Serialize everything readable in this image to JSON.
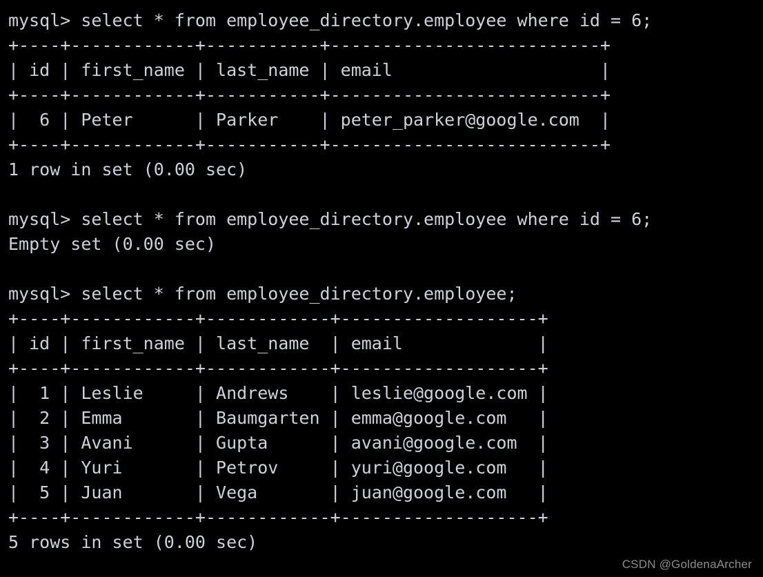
{
  "terminal": {
    "background_color": "#000000",
    "text_color": "#ccd2dc",
    "prompt": "mysql>",
    "lines": [
      {
        "id": "block1-prompt",
        "kind": "prompt",
        "text": "mysql> select * from employee_directory.employee where id = 6;"
      },
      {
        "id": "block1-rule-top",
        "kind": "rule",
        "text": "+----+------------+-----------+--------------------------+"
      },
      {
        "id": "block1-header",
        "kind": "table-row",
        "text": "| id | first_name | last_name | email                    |"
      },
      {
        "id": "block1-rule-mid",
        "kind": "rule",
        "text": "+----+------------+-----------+--------------------------+"
      },
      {
        "id": "block1-row-1",
        "kind": "table-row",
        "text": "|  6 | Peter      | Parker    | peter_parker@google.com  |"
      },
      {
        "id": "block1-rule-bottom",
        "kind": "rule",
        "text": "+----+------------+-----------+--------------------------+"
      },
      {
        "id": "block1-status",
        "kind": "status",
        "text": "1 row in set (0.00 sec)"
      },
      {
        "id": "spacer-1",
        "kind": "blank",
        "text": " "
      },
      {
        "id": "block2-prompt",
        "kind": "prompt",
        "text": "mysql> select * from employee_directory.employee where id = 6;"
      },
      {
        "id": "block2-status",
        "kind": "status",
        "text": "Empty set (0.00 sec)"
      },
      {
        "id": "spacer-2",
        "kind": "blank",
        "text": " "
      },
      {
        "id": "block3-prompt",
        "kind": "prompt",
        "text": "mysql> select * from employee_directory.employee;"
      },
      {
        "id": "block3-rule-top",
        "kind": "rule",
        "text": "+----+------------+------------+-------------------+"
      },
      {
        "id": "block3-header",
        "kind": "table-row",
        "text": "| id | first_name | last_name  | email             |"
      },
      {
        "id": "block3-rule-mid",
        "kind": "rule",
        "text": "+----+------------+------------+-------------------+"
      },
      {
        "id": "block3-row-1",
        "kind": "table-row",
        "text": "|  1 | Leslie     | Andrews    | leslie@google.com |"
      },
      {
        "id": "block3-row-2",
        "kind": "table-row",
        "text": "|  2 | Emma       | Baumgarten | emma@google.com   |"
      },
      {
        "id": "block3-row-3",
        "kind": "table-row",
        "text": "|  3 | Avani      | Gupta      | avani@google.com  |"
      },
      {
        "id": "block3-row-4",
        "kind": "table-row",
        "text": "|  4 | Yuri       | Petrov     | yuri@google.com   |"
      },
      {
        "id": "block3-row-5",
        "kind": "table-row",
        "text": "|  5 | Juan       | Vega       | juan@google.com   |"
      },
      {
        "id": "block3-rule-bottom",
        "kind": "rule",
        "text": "+----+------------+------------+-------------------+"
      },
      {
        "id": "block3-status",
        "kind": "status",
        "text": "5 rows in set (0.00 sec)"
      }
    ],
    "queries": [
      {
        "sql": "select * from employee_directory.employee where id = 6;",
        "status": "1 row in set (0.00 sec)",
        "columns": [
          "id",
          "first_name",
          "last_name",
          "email"
        ],
        "rows": [
          [
            "6",
            "Peter",
            "Parker",
            "peter_parker@google.com"
          ]
        ]
      },
      {
        "sql": "select * from employee_directory.employee where id = 6;",
        "status": "Empty set (0.00 sec)",
        "columns": [],
        "rows": []
      },
      {
        "sql": "select * from employee_directory.employee;",
        "status": "5 rows in set (0.00 sec)",
        "columns": [
          "id",
          "first_name",
          "last_name",
          "email"
        ],
        "rows": [
          [
            "1",
            "Leslie",
            "Andrews",
            "leslie@google.com"
          ],
          [
            "2",
            "Emma",
            "Baumgarten",
            "emma@google.com"
          ],
          [
            "3",
            "Avani",
            "Gupta",
            "avani@google.com"
          ],
          [
            "4",
            "Yuri",
            "Petrov",
            "yuri@google.com"
          ],
          [
            "5",
            "Juan",
            "Vega",
            "juan@google.com"
          ]
        ]
      }
    ]
  },
  "watermark": {
    "text": "CSDN @GoldenaArcher",
    "color": "#8c8c8c"
  }
}
